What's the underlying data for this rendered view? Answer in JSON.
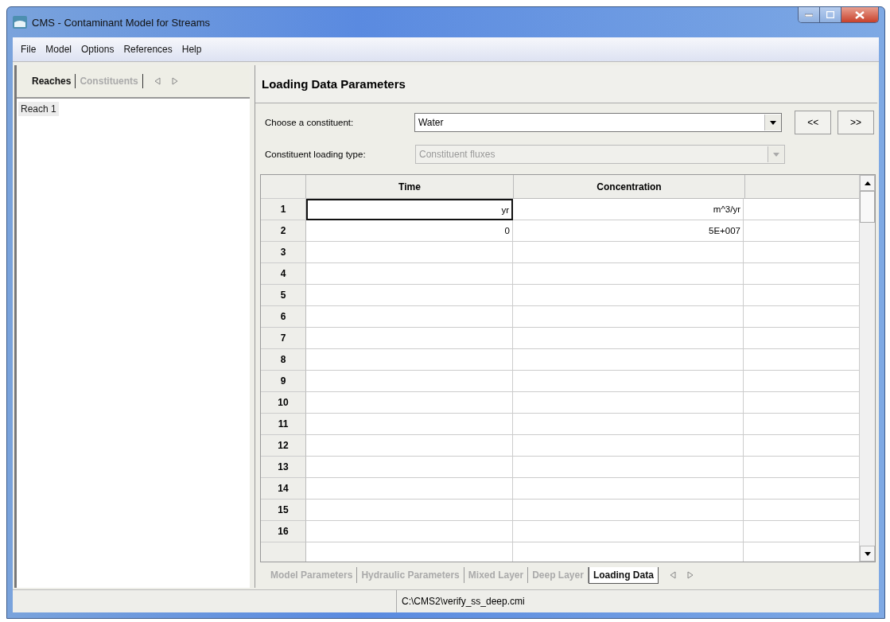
{
  "window": {
    "title": "CMS - Contaminant Model for Streams"
  },
  "menu": [
    "File",
    "Model",
    "Options",
    "References",
    "Help"
  ],
  "left_tabs": [
    {
      "label": "Reaches",
      "selected": true
    },
    {
      "label": "Constituents",
      "selected": false
    }
  ],
  "reaches": [
    {
      "label": "Reach 1",
      "selected": true
    }
  ],
  "panel": {
    "title": "Loading Data Parameters",
    "constituent_label": "Choose a constituent:",
    "constituent_value": "Water",
    "prev_button": "<<",
    "next_button": ">>",
    "loading_type_label": "Constituent loading type:",
    "loading_type_value": "Constituent fluxes",
    "loading_type_disabled": true
  },
  "table": {
    "columns": [
      "Time",
      "Concentration"
    ],
    "rows": [
      {
        "label": "1",
        "time": "yr",
        "concentration": "m^3/yr",
        "focused": true
      },
      {
        "label": "2",
        "time": "0",
        "concentration": "5E+007",
        "focused": false
      },
      {
        "label": "3",
        "time": "",
        "concentration": "",
        "focused": false
      },
      {
        "label": "4",
        "time": "",
        "concentration": "",
        "focused": false
      },
      {
        "label": "5",
        "time": "",
        "concentration": "",
        "focused": false
      },
      {
        "label": "6",
        "time": "",
        "concentration": "",
        "focused": false
      },
      {
        "label": "7",
        "time": "",
        "concentration": "",
        "focused": false
      },
      {
        "label": "8",
        "time": "",
        "concentration": "",
        "focused": false
      },
      {
        "label": "9",
        "time": "",
        "concentration": "",
        "focused": false
      },
      {
        "label": "10",
        "time": "",
        "concentration": "",
        "focused": false
      },
      {
        "label": "11",
        "time": "",
        "concentration": "",
        "focused": false
      },
      {
        "label": "12",
        "time": "",
        "concentration": "",
        "focused": false
      },
      {
        "label": "13",
        "time": "",
        "concentration": "",
        "focused": false
      },
      {
        "label": "14",
        "time": "",
        "concentration": "",
        "focused": false
      },
      {
        "label": "15",
        "time": "",
        "concentration": "",
        "focused": false
      },
      {
        "label": "16",
        "time": "",
        "concentration": "",
        "focused": false
      }
    ]
  },
  "bottom_tabs": [
    {
      "label": "Model Parameters",
      "selected": false
    },
    {
      "label": "Hydraulic Parameters",
      "selected": false
    },
    {
      "label": "Mixed Layer",
      "selected": false
    },
    {
      "label": "Deep Layer",
      "selected": false
    },
    {
      "label": "Loading Data",
      "selected": true
    }
  ],
  "status_bar": {
    "path": "C:\\CMS2\\verify_ss_deep.cmi"
  }
}
